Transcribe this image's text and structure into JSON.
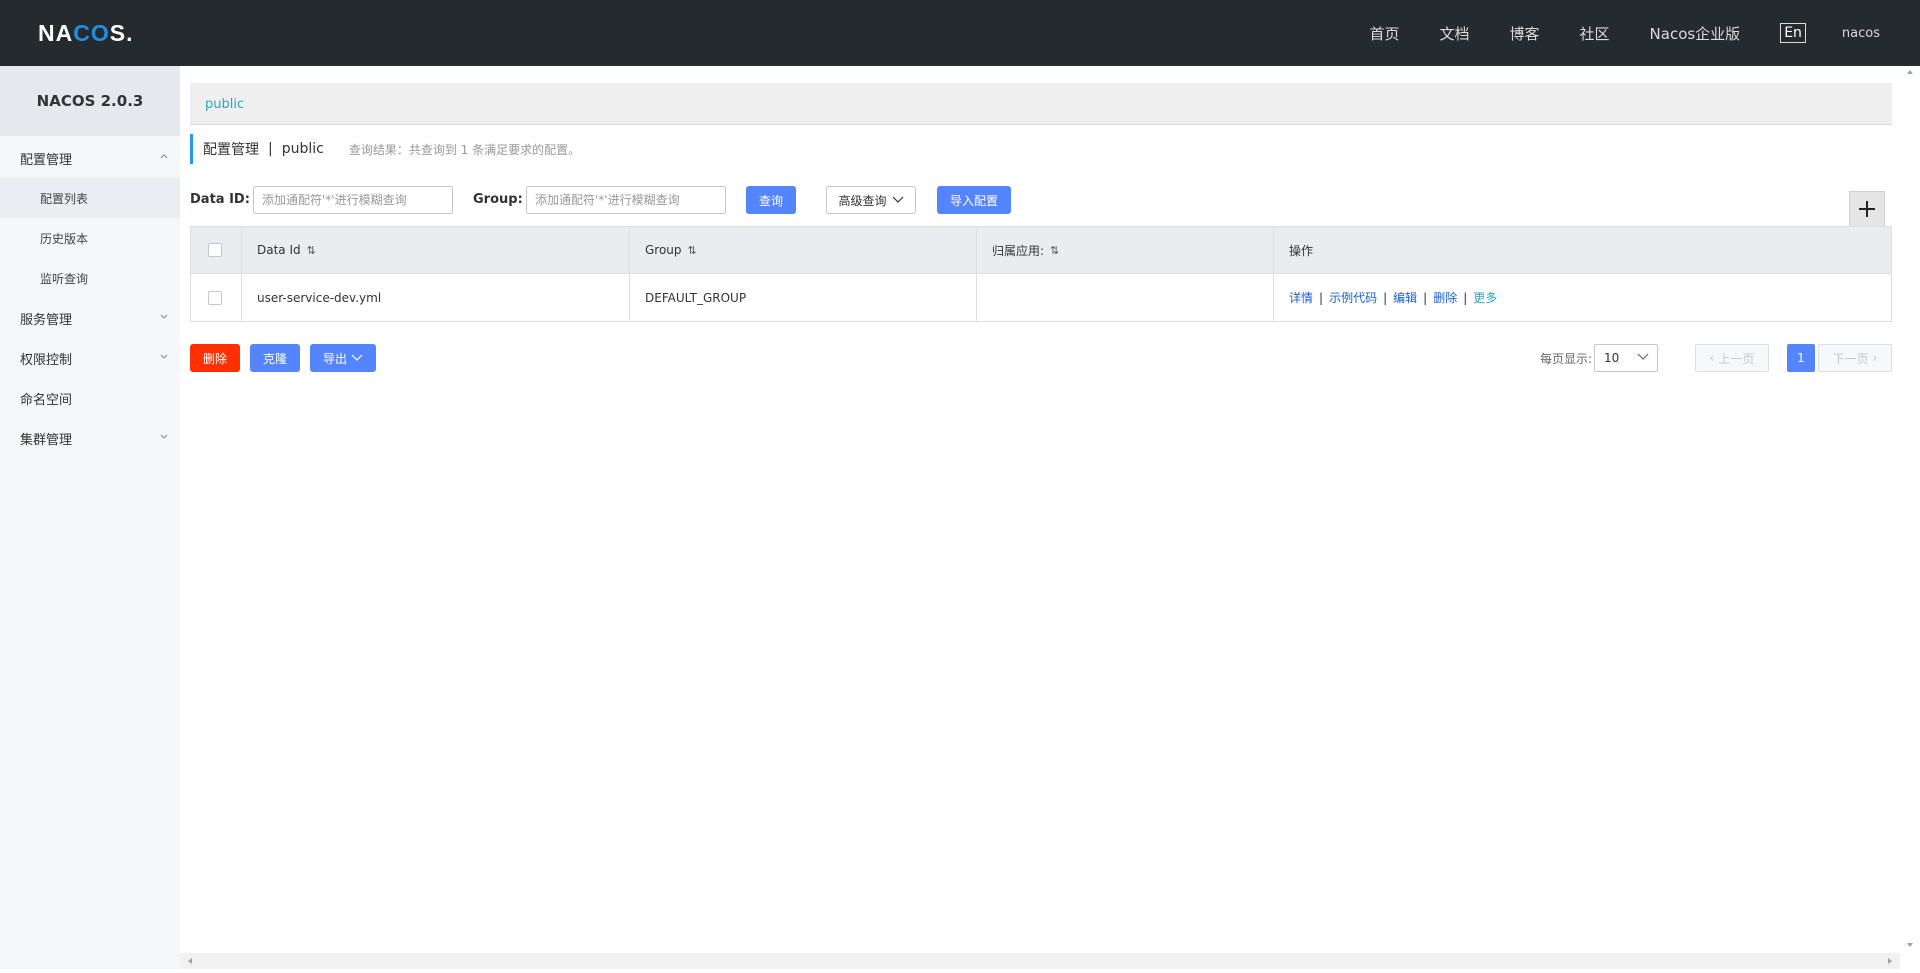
{
  "header": {
    "logo_left": "NA",
    "logo_mid": "CO",
    "logo_right": "S.",
    "nav": [
      "首页",
      "文档",
      "博客",
      "社区",
      "Nacos企业版"
    ],
    "lang": "En",
    "user": "nacos"
  },
  "sidebar": {
    "version": "NACOS 2.0.3",
    "menus": [
      {
        "label": "配置管理",
        "expanded": true,
        "children": [
          "配置列表",
          "历史版本",
          "监听查询"
        ]
      },
      {
        "label": "服务管理",
        "expanded": false
      },
      {
        "label": "权限控制",
        "expanded": false
      },
      {
        "label": "命名空间",
        "expanded": false
      },
      {
        "label": "集群管理",
        "expanded": false
      }
    ]
  },
  "breadcrumb": {
    "namespace": "public"
  },
  "title": {
    "main": "配置管理",
    "sep": "|",
    "namespace": "public",
    "result": "查询结果：共查询到 1 条满足要求的配置。"
  },
  "search": {
    "dataid_label": "Data ID:",
    "dataid_placeholder": "添加通配符'*'进行模糊查询",
    "group_label": "Group:",
    "group_placeholder": "添加通配符'*'进行模糊查询",
    "query_btn": "查询",
    "advanced_btn": "高级查询",
    "import_btn": "导入配置"
  },
  "table": {
    "headers": [
      "Data Id",
      "Group",
      "归属应用:",
      "操作"
    ],
    "rows": [
      {
        "data_id": "user-service-dev.yml",
        "group": "DEFAULT_GROUP",
        "app": ""
      }
    ],
    "ops": [
      "详情",
      "示例代码",
      "编辑",
      "删除",
      "更多"
    ]
  },
  "bottom": {
    "delete_btn": "删除",
    "clone_btn": "克隆",
    "export_btn": "导出",
    "page_size_label": "每页显示:",
    "page_size": "10",
    "prev": "上一页",
    "current_page": "1",
    "next": "下一页"
  },
  "colors": {
    "topbar": "#252a2f",
    "primary": "#5584ff",
    "danger": "#ff3000",
    "accent": "#209bfa"
  }
}
